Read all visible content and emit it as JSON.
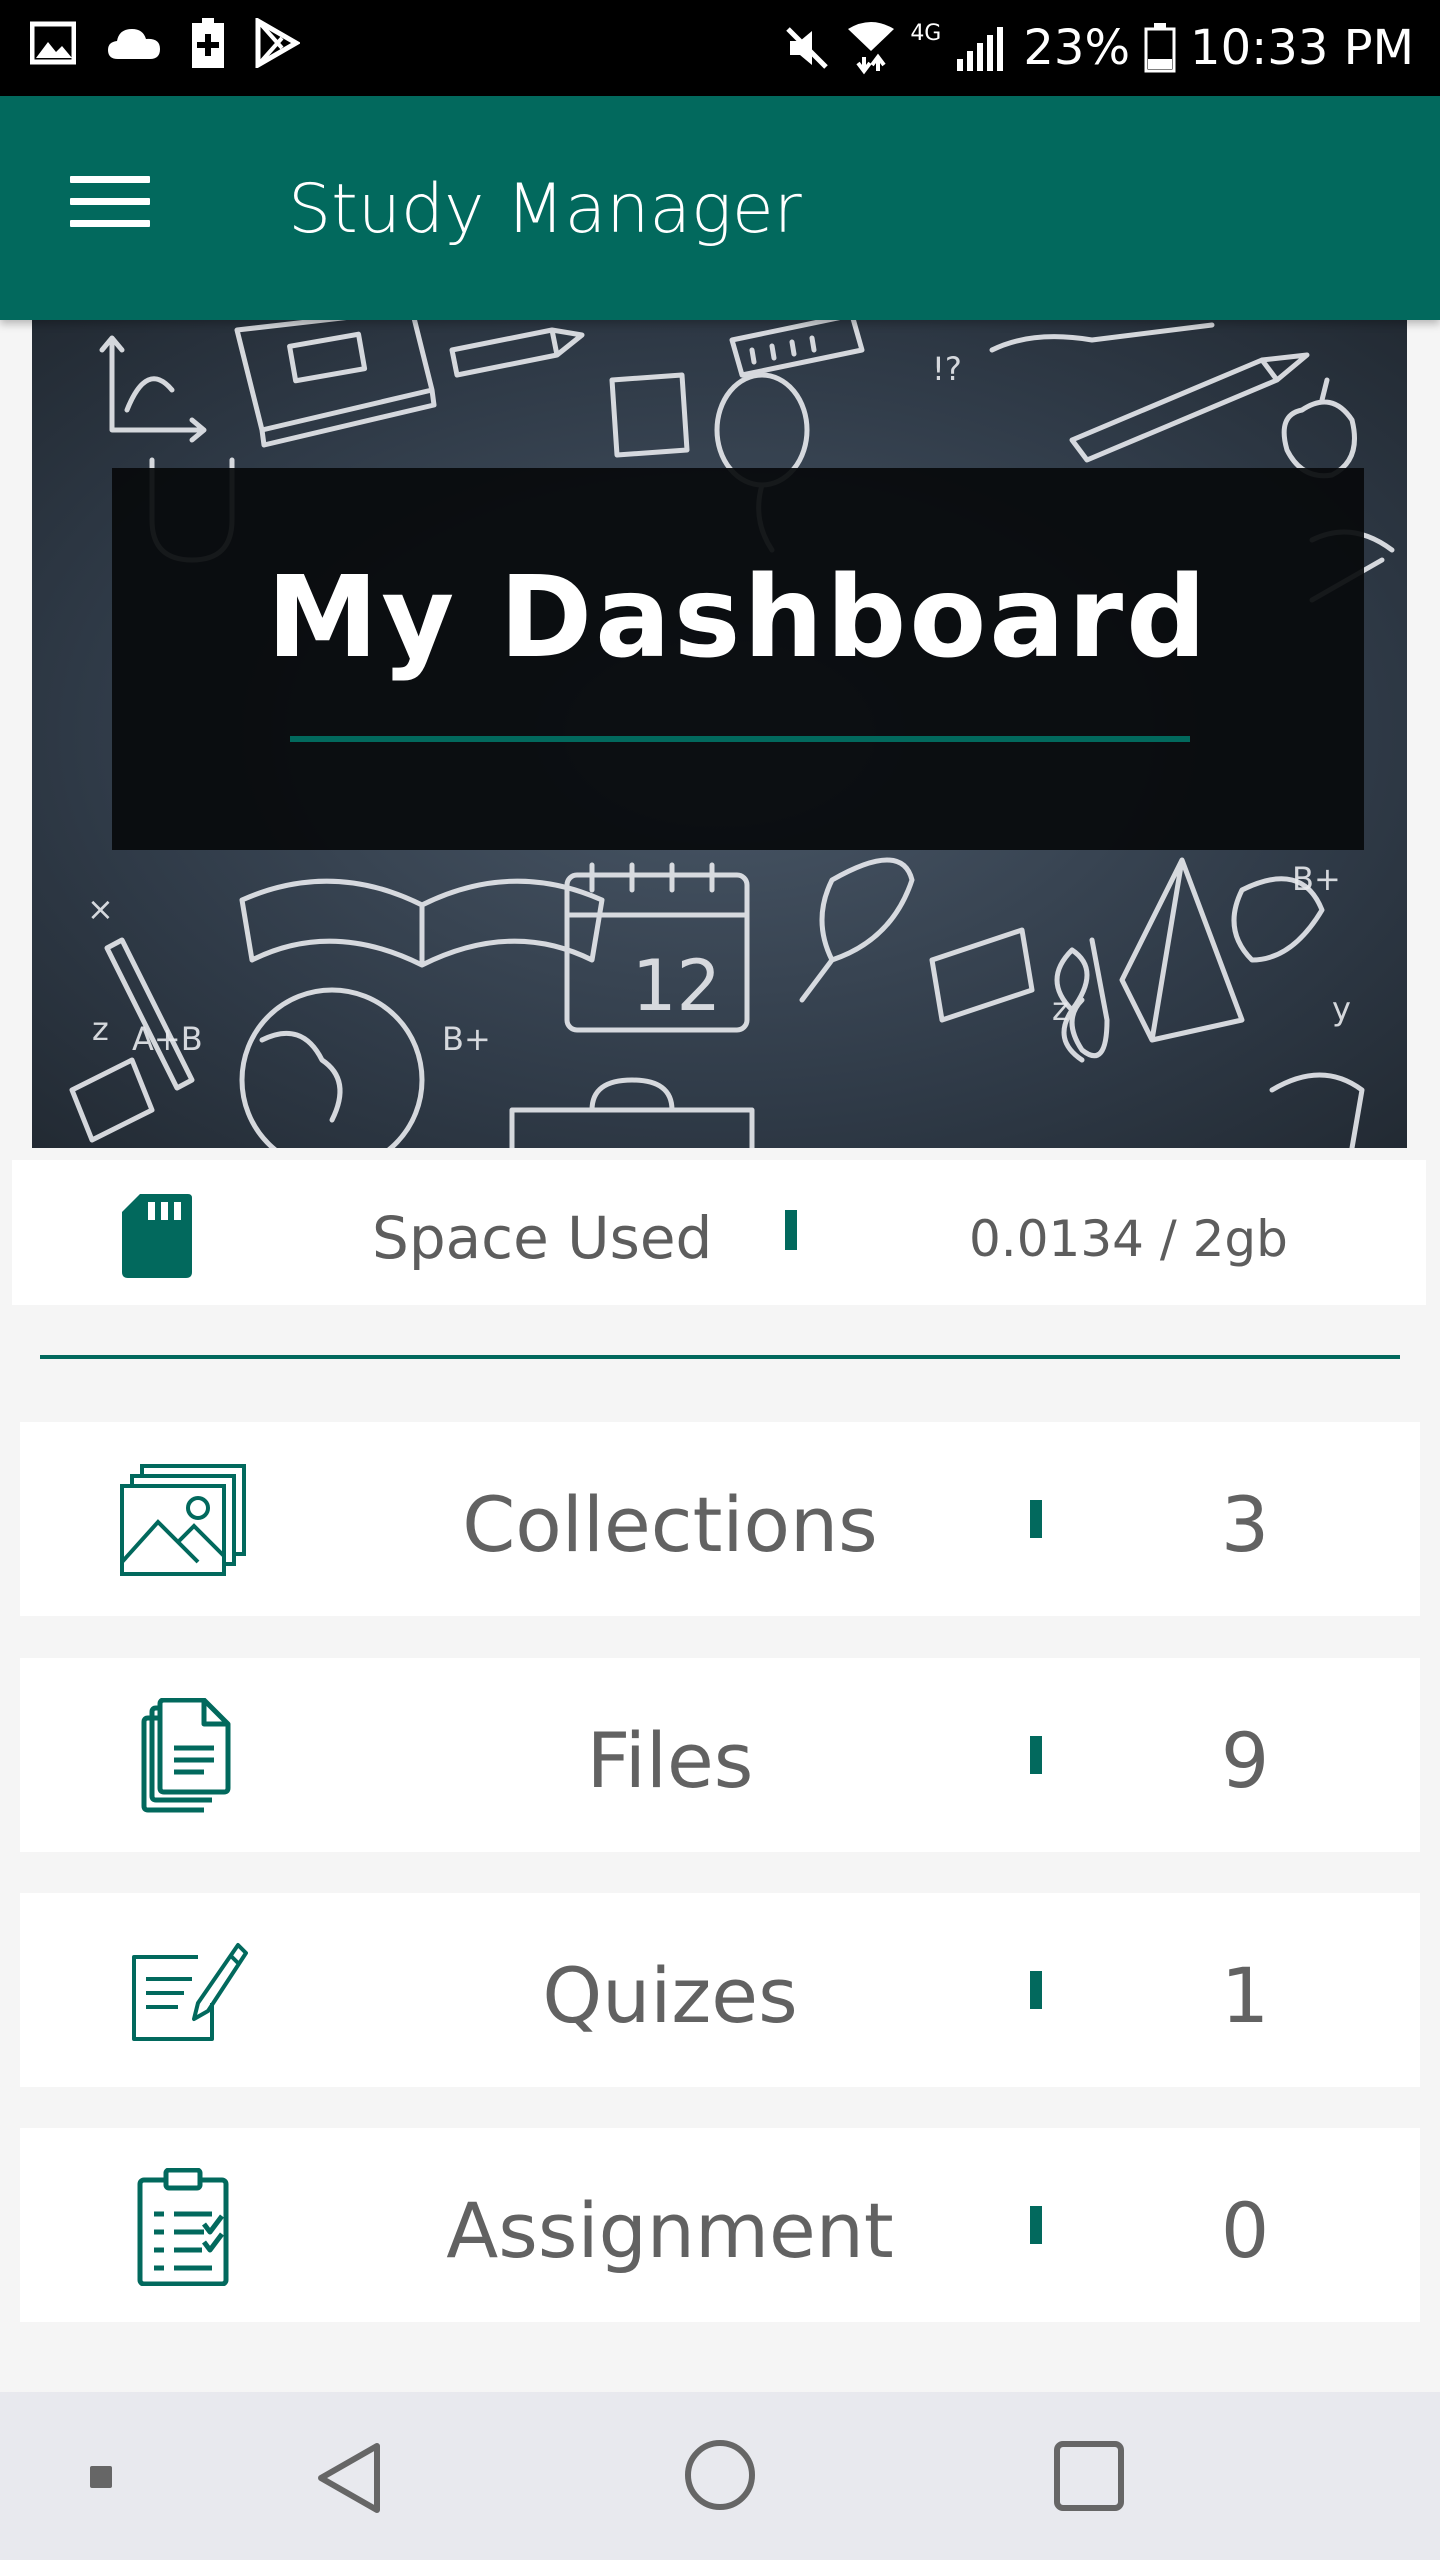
{
  "status_bar": {
    "battery_percent": "23%",
    "time": "10:33 PM",
    "network": "4G"
  },
  "app_bar": {
    "title": "Study Manager",
    "menu_icon": "hamburger-menu-icon"
  },
  "hero": {
    "title": "My Dashboard"
  },
  "storage": {
    "label": "Space Used",
    "value": "0.0134 / 2gb",
    "icon": "sd-card-icon"
  },
  "stats": [
    {
      "label": "Collections",
      "count": "3",
      "icon": "collections-icon"
    },
    {
      "label": "Files",
      "count": "9",
      "icon": "files-icon"
    },
    {
      "label": "Quizes",
      "count": "1",
      "icon": "quiz-icon"
    },
    {
      "label": "Assignment",
      "count": "0",
      "icon": "assignment-clipboard-icon"
    }
  ],
  "colors": {
    "primary": "#02695d",
    "text": "#626262",
    "background": "#f5f5f5"
  }
}
